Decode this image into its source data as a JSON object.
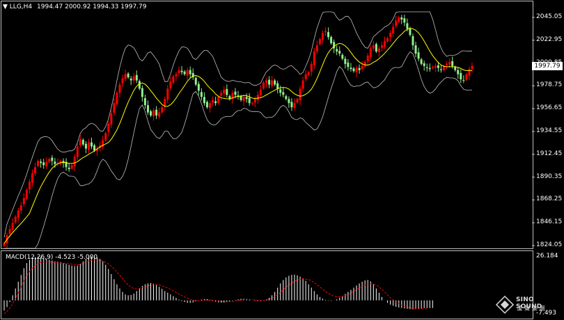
{
  "header": {
    "symbol_label": "LLG,H4",
    "ohlc": "1994.47 2000.92 1994.33 1997.79",
    "macd_label": "MACD(12,26,9) -4.523 -5.000"
  },
  "price_axis": {
    "ticks": [
      "2045.05",
      "2022.95",
      "2000.85",
      "1978.75",
      "1956.65",
      "1934.55",
      "1912.45",
      "1890.35",
      "1868.25",
      "1846.15",
      "1824.05"
    ],
    "current_price": "1997.79"
  },
  "macd_axis": {
    "top": "26.184",
    "bottom": "-7.493"
  },
  "logo": {
    "name": "SINO SOUND",
    "chinese": "漢聲集團",
    "icon": "diamond-logo-icon"
  },
  "colors": {
    "background": "#000000",
    "bull_candle": "#ff0000",
    "bear_candle": "#90ee90",
    "moving_average": "#ffff00",
    "bollinger_bands": "#c0c0c0",
    "macd_histogram": "#ffffff",
    "macd_signal": "#ff0000"
  },
  "chart_data": {
    "type": "candlestick",
    "title": "LLG,H4",
    "price_range": [
      1824.05,
      2045.05
    ],
    "closes": [
      1826,
      1834,
      1840,
      1846,
      1852,
      1858,
      1863,
      1870,
      1878,
      1886,
      1894,
      1900,
      1906,
      1904,
      1902,
      1905,
      1908,
      1906,
      1903,
      1904,
      1906,
      1904,
      1900,
      1898,
      1902,
      1910,
      1920,
      1927,
      1922,
      1918,
      1924,
      1920,
      1916,
      1918,
      1921,
      1926,
      1933,
      1942,
      1952,
      1962,
      1972,
      1980,
      1986,
      1990,
      1987,
      1984,
      1988,
      1984,
      1976,
      1968,
      1960,
      1953,
      1950,
      1955,
      1950,
      1953,
      1958,
      1966,
      1976,
      1983,
      1988,
      1990,
      1994,
      1992,
      1990,
      1994,
      1990,
      1987,
      1980,
      1974,
      1968,
      1962,
      1958,
      1962,
      1965,
      1962,
      1968,
      1972,
      1975,
      1970,
      1966,
      1972,
      1970,
      1968,
      1965,
      1968,
      1966,
      1962,
      1962,
      1966,
      1970,
      1975,
      1982,
      1984,
      1980,
      1984,
      1980,
      1976,
      1972,
      1970,
      1966,
      1962,
      1958,
      1962,
      1966,
      1976,
      1984,
      1990,
      1992,
      2000,
      2012,
      2018,
      2024,
      2030,
      2032,
      2026,
      2020,
      2015,
      2012,
      2010,
      2005,
      2000,
      1997,
      1995,
      1993,
      1996,
      1994,
      1998,
      2002,
      2008,
      2015,
      2018,
      2012,
      2015,
      2018,
      2022,
      2025,
      2030,
      2036,
      2042,
      2045,
      2043,
      2040,
      2034,
      2028,
      2018,
      2010,
      2005,
      2000,
      1998,
      1996,
      1995,
      1997,
      1998,
      1996,
      1994,
      1998,
      2000,
      2002,
      1998,
      1994,
      1990,
      1985,
      1984,
      1990,
      1995,
      1998
    ],
    "macd_range": [
      -7.493,
      26.184
    ],
    "macd": [
      -6,
      -4,
      -1,
      3,
      7,
      11,
      15,
      19,
      22,
      24,
      25,
      25.5,
      25.8,
      25.6,
      25,
      24.5,
      24,
      23.5,
      23,
      22.8,
      22.5,
      22,
      21.5,
      21,
      20.5,
      20.2,
      20.5,
      21.5,
      23,
      24.5,
      25.5,
      26,
      25.8,
      25.3,
      24.5,
      23,
      21,
      18.5,
      15.5,
      12.5,
      9.5,
      7,
      5,
      3.5,
      3,
      3.2,
      4,
      5.5,
      7,
      8.5,
      9.5,
      10,
      10.2,
      9.8,
      9,
      8,
      6.8,
      5.5,
      4.5,
      3.5,
      2.5,
      1.5,
      0.5,
      -0.5,
      -1,
      -1.5,
      -1.5,
      -1.2,
      -0.6,
      0,
      0.5,
      0.8,
      0.7,
      0.3,
      -0.3,
      -0.8,
      -1.2,
      -1.4,
      -1.3,
      -1,
      -0.6,
      -0.2,
      0.2,
      0.6,
      0.9,
      1,
      0.8,
      0.4,
      0,
      -0.3,
      -0.5,
      -0.5,
      -0.2,
      0.5,
      1.5,
      3,
      5,
      7.5,
      10,
      12,
      13.5,
      14.5,
      15,
      15.2,
      14.8,
      14,
      13,
      11.5,
      9.5,
      7.5,
      5.5,
      3.5,
      2,
      1,
      0.3,
      -0.2,
      -0.3,
      0,
      0.6,
      1.5,
      2.5,
      3.8,
      5,
      6.2,
      7.5,
      8.8,
      10,
      11,
      11.8,
      12,
      11.2,
      9.5,
      7,
      4.5,
      2,
      0,
      -1.5,
      -2.5,
      -3.2,
      -3.8,
      -4.2,
      -4.5,
      -4.8,
      -5,
      -5.2,
      -5.3,
      -5.2,
      -5,
      -4.8,
      -4.6,
      -4.5,
      -4.5,
      -4.52
    ],
    "macd_signal": [
      -8,
      -6.5,
      -4.5,
      -2,
      1,
      4.5,
      8,
      11.5,
      14.5,
      17,
      19,
      20.5,
      21.5,
      22.3,
      22.7,
      22.8,
      22.7,
      22.6,
      22.4,
      22.2,
      22,
      21.9,
      21.8,
      21.6,
      21.4,
      21.2,
      21,
      21.2,
      21.8,
      22.5,
      23.2,
      23.7,
      23.8,
      23.8,
      23.6,
      23.2,
      22.5,
      21.5,
      20.2,
      18.6,
      16.8,
      14.8,
      12.8,
      10.8,
      9,
      7.8,
      7,
      6.8,
      7,
      7.5,
      8,
      8.5,
      8.9,
      9.2,
      9.2,
      9,
      8.6,
      8,
      7.3,
      6.5,
      5.6,
      4.7,
      3.8,
      2.9,
      2,
      1.3,
      0.7,
      0.2,
      -0.1,
      -0.2,
      -0.1,
      0.1,
      0.2,
      0.2,
      0.1,
      -0.1,
      -0.4,
      -0.6,
      -0.8,
      -0.9,
      -0.8,
      -0.6,
      -0.4,
      -0.1,
      0.2,
      0.4,
      0.5,
      0.5,
      0.4,
      0.2,
      0,
      -0.1,
      -0.1,
      0.1,
      0.5,
      1.2,
      2.1,
      3.3,
      4.7,
      6.2,
      7.7,
      9,
      10.2,
      11.2,
      12,
      12.5,
      12.7,
      12.6,
      12.2,
      11.5,
      10.5,
      9.3,
      8,
      6.6,
      5.3,
      4.1,
      3.2,
      2.5,
      2.1,
      2.1,
      2.4,
      2.9,
      3.6,
      4.4,
      5.3,
      6.3,
      7.3,
      8.3,
      9.1,
      9.7,
      9.9,
      9.7,
      9,
      7.9,
      6.5,
      4.9,
      3.2,
      1.6,
      0.2,
      -1,
      -2,
      -2.9,
      -3.6,
      -4.1,
      -4.5,
      -4.8,
      -4.9,
      -5,
      -5,
      -5,
      -5
    ]
  }
}
